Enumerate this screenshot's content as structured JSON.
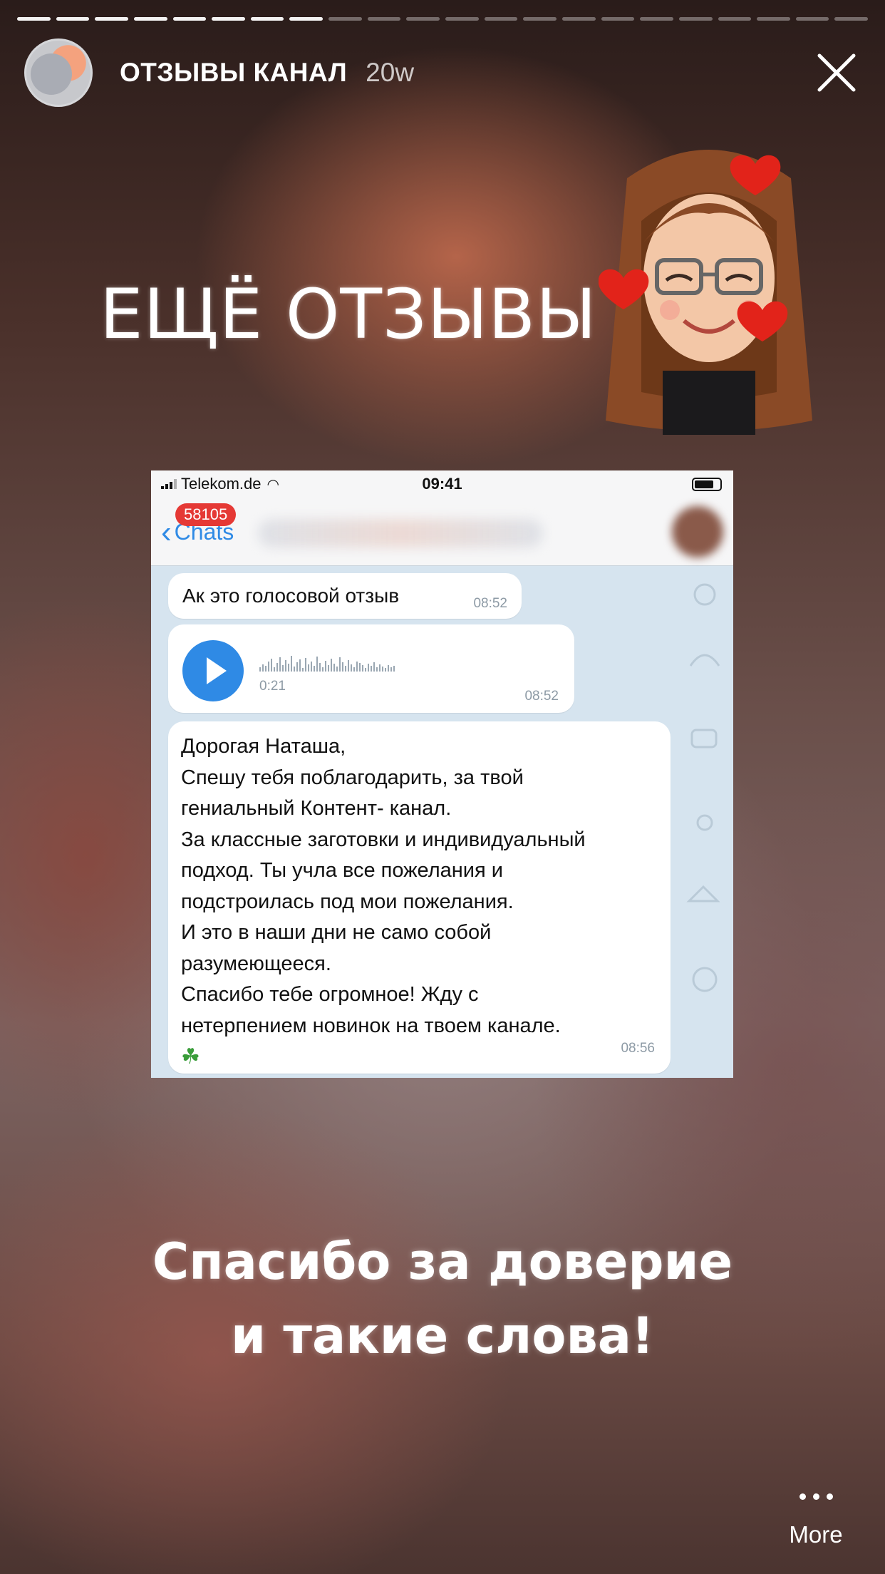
{
  "story": {
    "segments_total": 22,
    "segments_viewed": 8,
    "channel_name": "ОТЗЫВЫ КАНАЛ",
    "age": "20w",
    "headline": "ЕЩЁ ОТЗЫВЫ",
    "caption_line1": "Спасибо за доверие",
    "caption_line2": "и такие слова!",
    "more_label": "More"
  },
  "screenshot": {
    "carrier": "Telekom.de",
    "time": "09:41",
    "back_label": "Chats",
    "unread_badge": "58105",
    "messages": {
      "m1_text": "Ак это голосовой отзыв",
      "m1_time": "08:52",
      "voice_duration": "0:21",
      "voice_time": "08:52",
      "m3_lines": [
        "Дорогая Наташа,",
        "Спешу тебя поблагодарить, за твой",
        "гениальный Контент- канал.",
        "За классные заготовки и индивидуальный",
        "подход. Ты учла все пожелания и",
        "подстроилась под мои пожелания.",
        "И это в наши дни не само собой",
        "разумеющееся.",
        "Спасибо тебе огромное! Жду с",
        "нетерпением новинок на твоем канале."
      ],
      "m3_emoji": "☘",
      "m3_time": "08:56"
    }
  },
  "colors": {
    "accent": "#2f8ae5",
    "badge": "#e53935",
    "chat_bg": "#d6e4ef"
  }
}
